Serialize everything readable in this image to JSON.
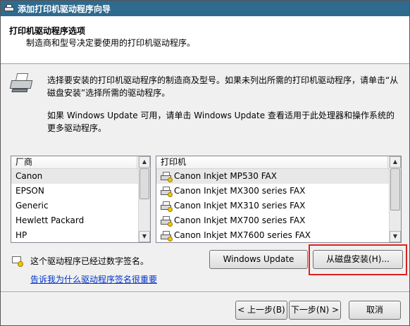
{
  "window": {
    "title": "添加打印机驱动程序向导"
  },
  "header": {
    "title": "打印机驱动程序选项",
    "subtitle": "制造商和型号决定要使用的打印机驱动程序。"
  },
  "intro": {
    "line1": "选择要安装的打印机驱动程序的制造商及型号。如果未列出所需的打印机驱动程序，请单击“从磁盘安装”选择所需的驱动程序。",
    "line2": "如果 Windows Update 可用，请单击 Windows Update 查看适用于此处理器和操作系统的更多驱动程序。"
  },
  "manufacturers": {
    "header": "厂商",
    "items": [
      "Canon",
      "EPSON",
      "Generic",
      "Hewlett Packard",
      "HP"
    ],
    "selected": "Canon"
  },
  "printers": {
    "header": "打印机",
    "items": [
      "Canon Inkjet MP530 FAX",
      "Canon Inkjet MX300 series FAX",
      "Canon Inkjet MX310 series FAX",
      "Canon Inkjet MX700 series FAX",
      "Canon Inkjet MX7600 series FAX"
    ],
    "selected": "Canon Inkjet MP530 FAX"
  },
  "status": {
    "signed_text": "这个驱动程序已经过数字签名。",
    "link_text": "告诉我为什么驱动程序签名很重要"
  },
  "buttons": {
    "windows_update": "Windows Update",
    "have_disk": "从磁盘安装(H)...",
    "back": "< 上一步(B)",
    "next": "下一步(N) >",
    "cancel": "取消"
  },
  "icons": {
    "title": "printer-icon",
    "wizard": "printer-icon",
    "driver": "certified-driver-icon",
    "status": "certificate-icon"
  },
  "colors": {
    "titlebar": "#2f6a8f",
    "link": "#0033cc",
    "highlight": "#e02020"
  }
}
